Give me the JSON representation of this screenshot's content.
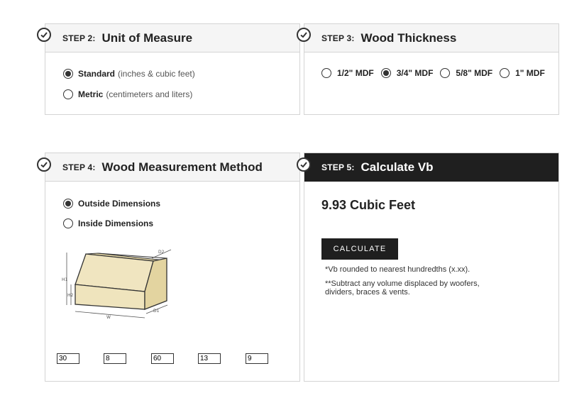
{
  "step2": {
    "step_label": "STEP 2:",
    "title": "Unit of Measure",
    "options": [
      {
        "label": "Standard",
        "detail": "(inches & cubic feet)",
        "selected": true
      },
      {
        "label": "Metric",
        "detail": "(centimeters and liters)",
        "selected": false
      }
    ]
  },
  "step3": {
    "step_label": "STEP 3:",
    "title": "Wood Thickness",
    "options": [
      {
        "label": "1/2\" MDF",
        "selected": false
      },
      {
        "label": "3/4\" MDF",
        "selected": true
      },
      {
        "label": "5/8\" MDF",
        "selected": false
      },
      {
        "label": "1\" MDF",
        "selected": false
      }
    ]
  },
  "step4": {
    "step_label": "STEP 4:",
    "title": "Wood Measurement Method",
    "options": [
      {
        "label": "Outside Dimensions",
        "selected": true
      },
      {
        "label": "Inside Dimensions",
        "selected": false
      }
    ],
    "diagram_labels": {
      "w": "W",
      "h1": "H1",
      "h2": "H2",
      "d1": "D1",
      "d2": "D2"
    },
    "inputs": [
      "30",
      "8",
      "60",
      "13",
      "9"
    ]
  },
  "step5": {
    "step_label": "STEP 5:",
    "title": "Calculate Vb",
    "result": "9.93 Cubic Feet",
    "button_label": "CALCULATE",
    "note1": "*Vb rounded to nearest hundredths (x.xx).",
    "note2": "**Subtract any volume displaced by woofers, dividers, braces & vents."
  },
  "colors": {
    "dark": "#1f1f1f",
    "border": "#d4d4d4",
    "header_bg": "#f5f5f5",
    "box_fill": "#efe4bd"
  }
}
